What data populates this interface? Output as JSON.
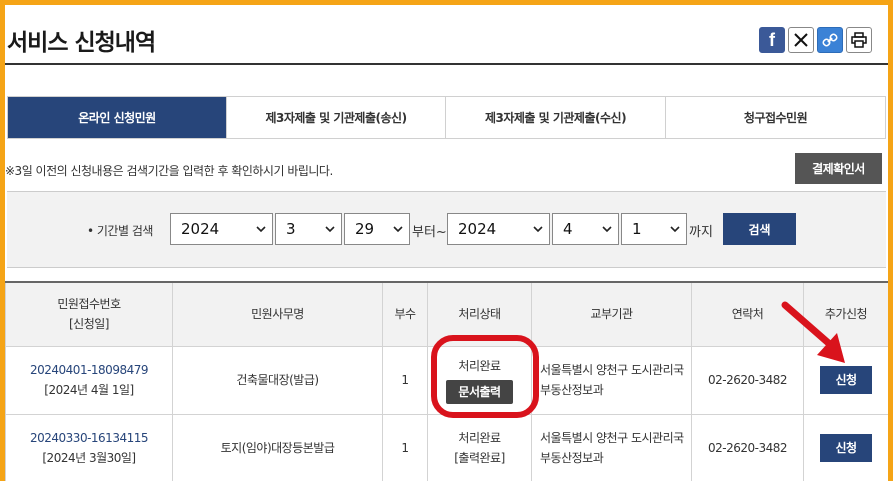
{
  "page": {
    "title": "서비스 신청내역"
  },
  "share": {
    "icons": [
      "facebook-icon",
      "x-icon",
      "link-icon",
      "print-icon"
    ],
    "facebook_glyph": "f"
  },
  "tabs": [
    {
      "label": "온라인 신청민원",
      "active": true
    },
    {
      "label": "제3자제출 및 기관제출(송신)",
      "active": false
    },
    {
      "label": "제3자제출 및 기관제출(수신)",
      "active": false
    },
    {
      "label": "청구접수민원",
      "active": false
    }
  ],
  "notice": "※3일 이전의 신청내용은 검색기간을 입력한 후 확인하시기 바립니다.",
  "buttons": {
    "payment_confirm": "결제확인서",
    "search": "검색"
  },
  "search": {
    "label": "• 기간별 검색",
    "from": {
      "year": "2024",
      "month": "3",
      "day": "29"
    },
    "from_suffix": "부터~",
    "to": {
      "year": "2024",
      "month": "4",
      "day": "1"
    },
    "to_suffix": "까지"
  },
  "table": {
    "headers": {
      "receipt": "민원접수번호",
      "receipt_sub": "[신청일]",
      "affair": "민원사무명",
      "copies": "부수",
      "status": "처리상태",
      "agency": "교부기관",
      "contact": "연락처",
      "extra": "추가신청"
    },
    "rows": [
      {
        "receipt_no": "20240401-18098479",
        "date": "[2024년 4월 1일]",
        "affair": "건축물대장(발급)",
        "copies": "1",
        "status": "처리완료",
        "status_action": "문서출력",
        "agency_line1": "서울특별시 양천구 도시관리국",
        "agency_line2": "부동산정보과",
        "contact": "02-2620-3482",
        "apply": "신청"
      },
      {
        "receipt_no": "20240330-16134115",
        "date": "[2024년 3월30일]",
        "affair": "토지(임야)대장등본발급",
        "copies": "1",
        "status": "처리완료",
        "status_action": "[출력완료]",
        "agency_line1": "서울특별시 양천구 도시관리국",
        "agency_line2": "부동산정보과",
        "contact": "02-2620-3482",
        "apply": "신청"
      }
    ]
  },
  "colors": {
    "accent_navy": "#27457a",
    "frame_orange": "#f5a416",
    "highlight_red": "#d9131c"
  }
}
